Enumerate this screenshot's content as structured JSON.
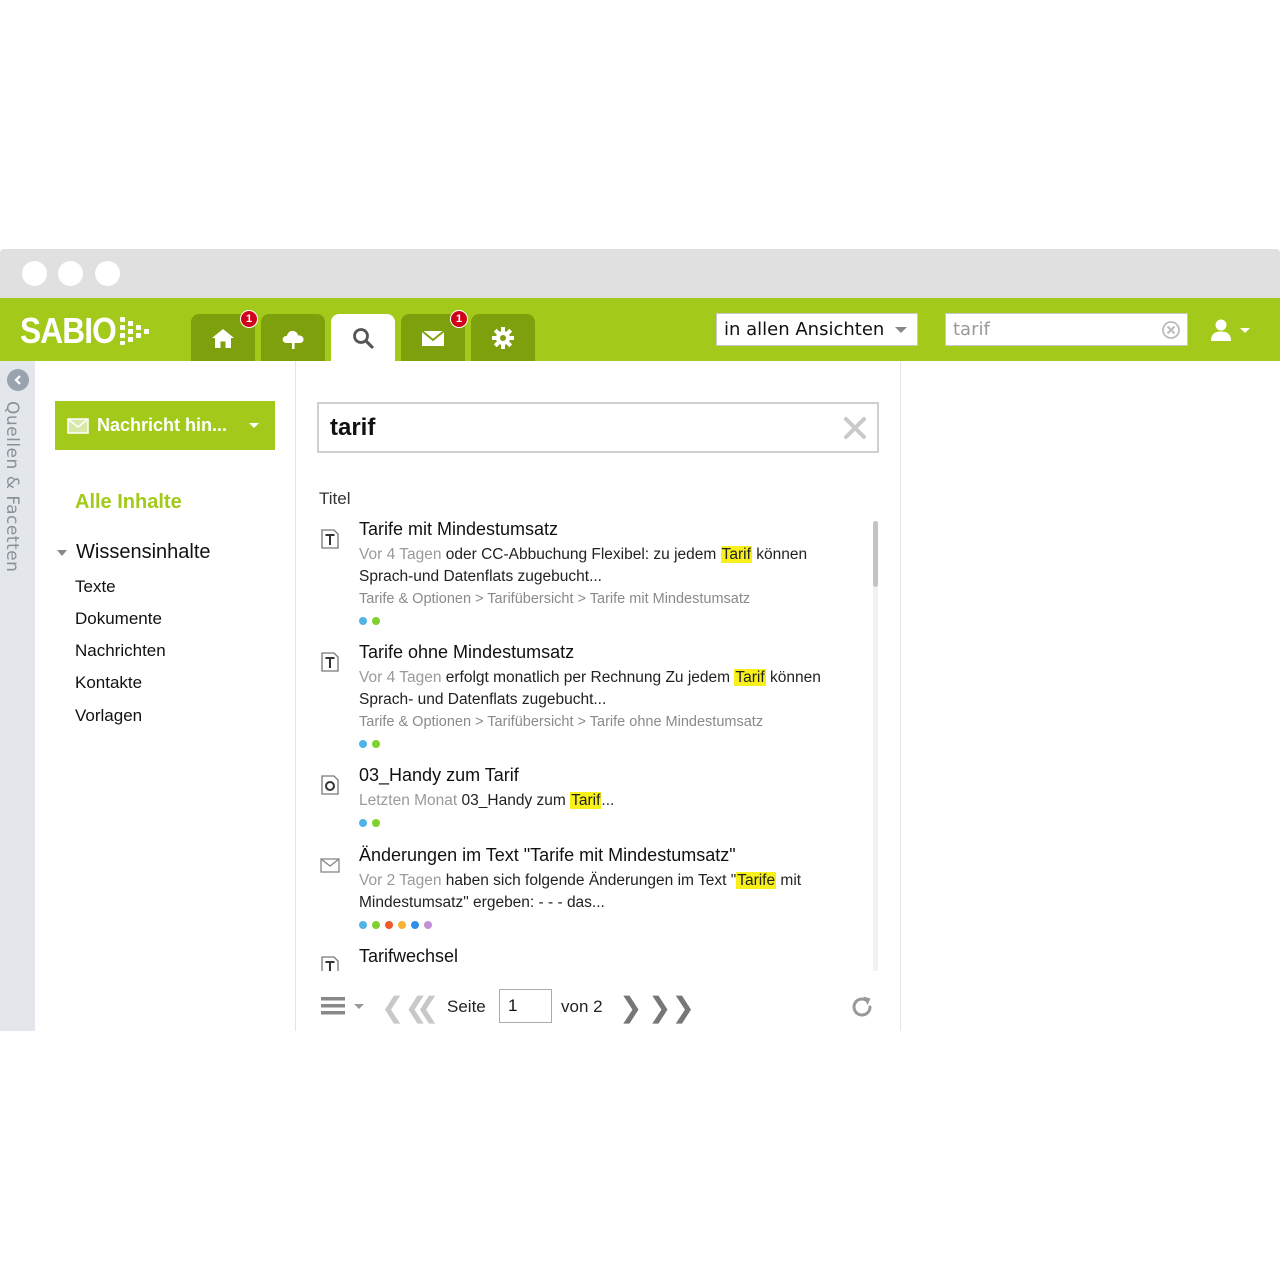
{
  "app": {
    "logo_text": "SABIO",
    "brand_color": "#a3c91a",
    "tab_dark_color": "#7fa00d"
  },
  "nav": {
    "tabs": [
      {
        "name": "home-icon",
        "badge": "1"
      },
      {
        "name": "cloud-icon",
        "badge": ""
      },
      {
        "name": "search-icon",
        "badge": "",
        "active": true
      },
      {
        "name": "mail-icon",
        "badge": "1"
      },
      {
        "name": "gear-icon",
        "badge": ""
      }
    ]
  },
  "header": {
    "scope_select": "in allen Ansichten",
    "search_value": "tarif",
    "user_icon": "user-icon"
  },
  "rail": {
    "label": "Quellen & Facetten"
  },
  "sidebar": {
    "compose_label": "Nachricht hin...",
    "all_content": "Alle Inhalte",
    "group": "Wissensinhalte",
    "items": [
      "Texte",
      "Dokumente",
      "Nachrichten",
      "Kontakte",
      "Vorlagen"
    ]
  },
  "main": {
    "query": "tarif",
    "column_header": "Titel",
    "results": [
      {
        "type": "text",
        "title": "Tarife mit Mindestumsatz",
        "age": "Vor 4 Tagen",
        "pre": " oder CC-Abbuchung Flexibel: zu jedem ",
        "hit": "Tarif",
        "post": " können Sprach-und Datenflats zugebucht...",
        "crumbs": "Tarife & Optionen > Tarifübersicht > Tarife mit Mindestumsatz",
        "dots": [
          "#4fb3e8",
          "#7fd12b"
        ]
      },
      {
        "type": "text",
        "title": "Tarife ohne Mindestumsatz",
        "age": "Vor 4 Tagen",
        "pre": " erfolgt monatlich per Rechnung Zu jedem ",
        "hit": "Tarif",
        "post": " können Sprach- und Datenflats zugebucht...",
        "crumbs": "Tarife & Optionen > Tarifübersicht > Tarife ohne Mindestumsatz",
        "dots": [
          "#4fb3e8",
          "#7fd12b"
        ]
      },
      {
        "type": "document",
        "title": "03_Handy zum Tarif",
        "age": "Letzten Monat",
        "pre": " 03_Handy zum ",
        "hit": "Tarif",
        "post": "...",
        "crumbs": "",
        "dots": [
          "#4fb3e8",
          "#7fd12b"
        ]
      },
      {
        "type": "message",
        "title": "Änderungen im Text \"Tarife mit Mindestumsatz\"",
        "age": "Vor 2 Tagen",
        "pre": " haben sich folgende Änderungen im Text \"",
        "hit": "Tarife",
        "post": " mit Mindestumsatz\" ergeben: - - - das...",
        "crumbs": "",
        "dots": [
          "#4fb3e8",
          "#7fd12b",
          "#f05a28",
          "#f5b335",
          "#2f8fe8",
          "#c38fd6"
        ]
      },
      {
        "type": "text",
        "title": "Tarifwechsel",
        "age": "",
        "pre": "",
        "hit": "",
        "post": "",
        "crumbs": "",
        "dots": []
      }
    ]
  },
  "pager": {
    "page_label": "Seite",
    "page_value": "1",
    "of_label": "von 2"
  }
}
